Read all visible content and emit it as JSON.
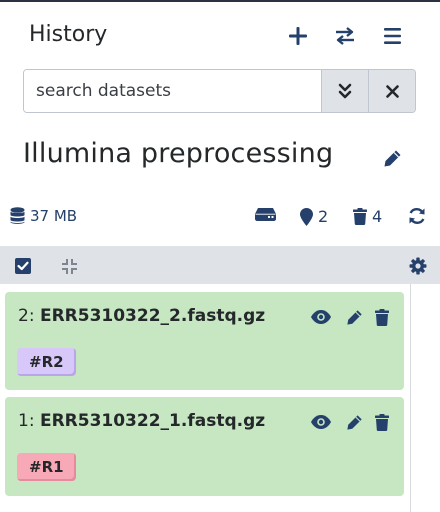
{
  "header": {
    "title": "History",
    "icons": [
      "plus-icon",
      "switch-icon",
      "bars-icon"
    ]
  },
  "search": {
    "placeholder": "search datasets",
    "value": ""
  },
  "history": {
    "name": "Illumina preprocessing",
    "size": "37 MB",
    "shown_count": "2",
    "deleted_count": "4"
  },
  "colors": {
    "item_ok": "#c6e7c2",
    "tag_r2": "#d7c8f9",
    "tag_r1": "#f8a9b8",
    "icon_dark": "#25406b",
    "toolbar_bg": "#dfe3e8"
  },
  "datasets": [
    {
      "hid": "2:",
      "name": "ERR5310322_2.fastq.gz",
      "tag": "#R2"
    },
    {
      "hid": "1:",
      "name": "ERR5310322_1.fastq.gz",
      "tag": "#R1"
    }
  ]
}
